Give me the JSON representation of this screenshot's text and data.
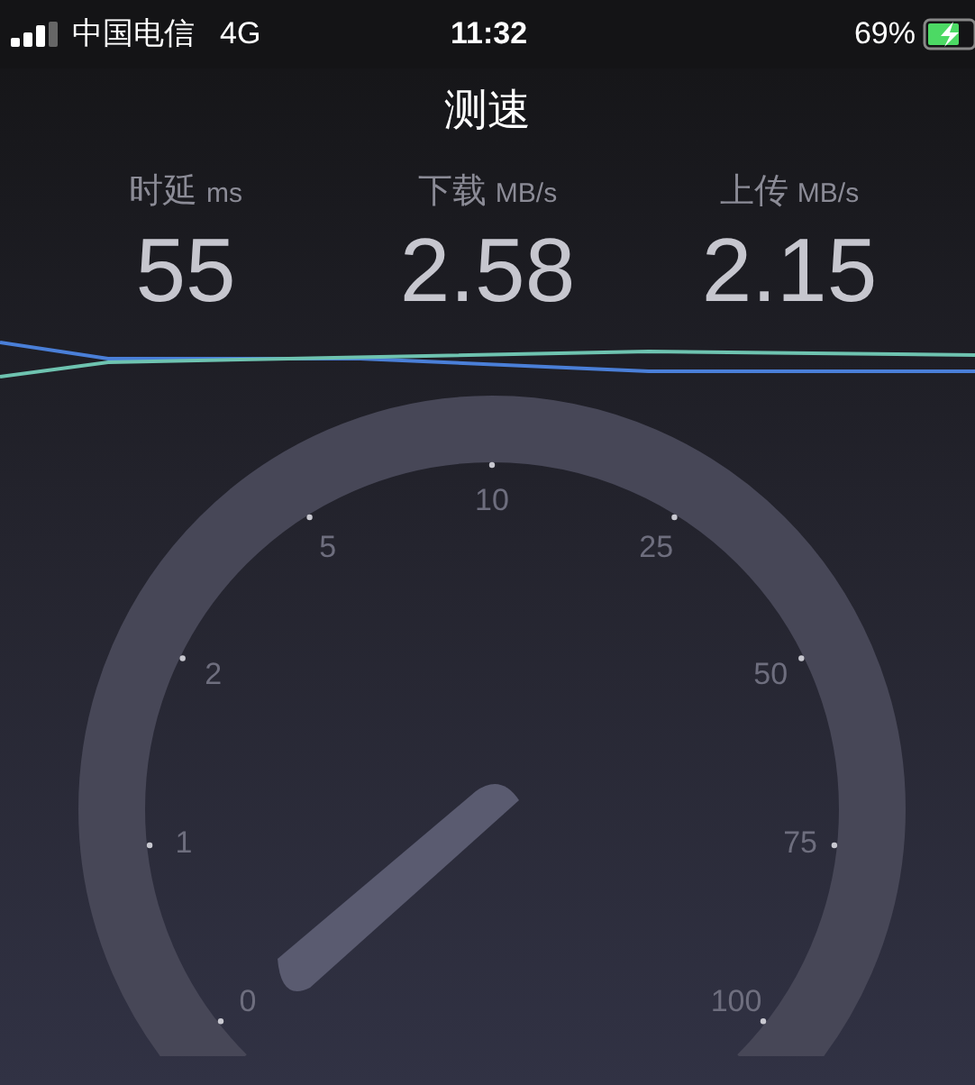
{
  "status_bar": {
    "carrier": "中国电信",
    "network": "4G",
    "time": "11:32",
    "battery": "69%"
  },
  "title": "测速",
  "stats": [
    {
      "label": "时延",
      "unit": "ms",
      "value": "55"
    },
    {
      "label": "下载",
      "unit": "MB/s",
      "value": "2.58"
    },
    {
      "label": "上传",
      "unit": "MB/s",
      "value": "2.15"
    }
  ],
  "gauge": {
    "ticks": [
      "0",
      "1",
      "2",
      "5",
      "10",
      "25",
      "50",
      "75",
      "100"
    ]
  }
}
